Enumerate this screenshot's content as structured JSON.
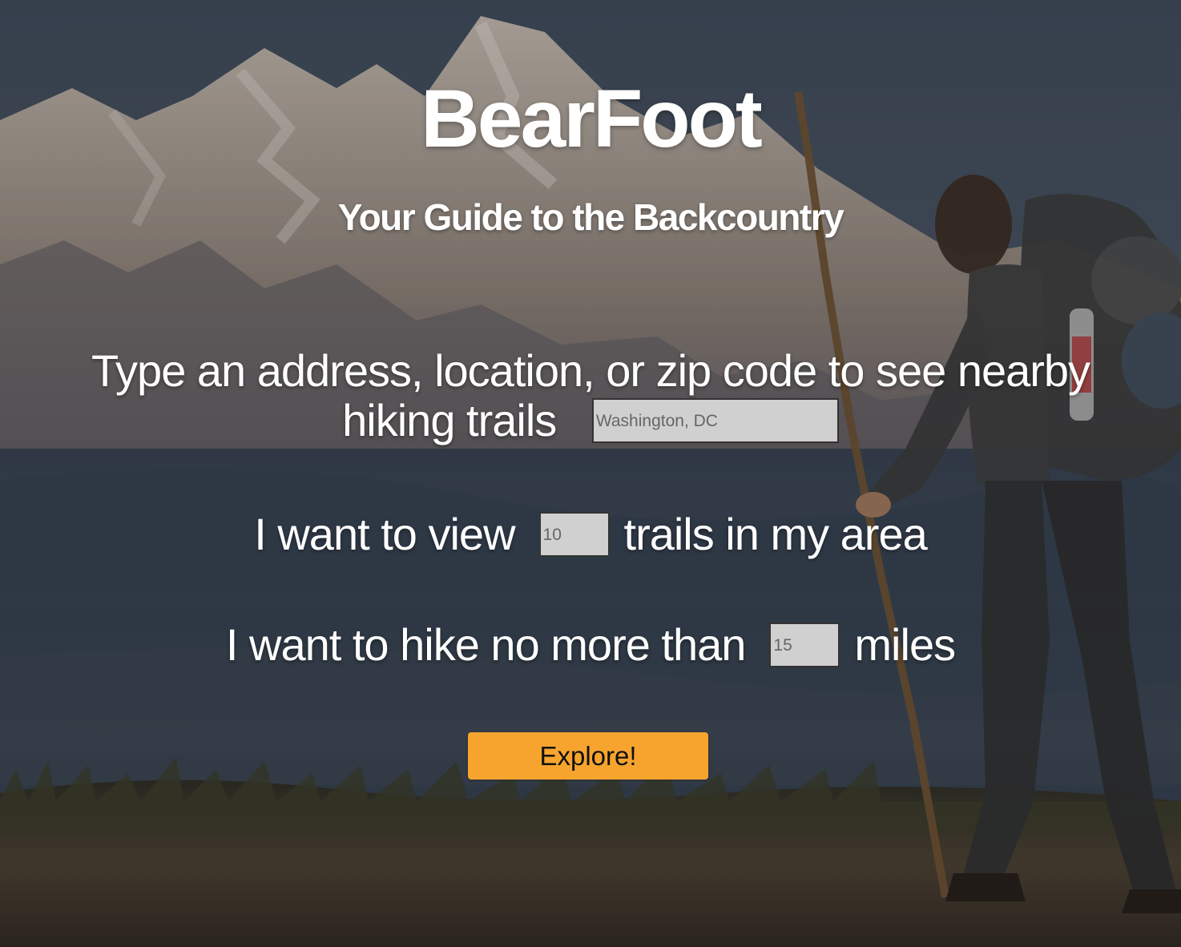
{
  "brand": {
    "title": "BearFoot",
    "tagline": "Your Guide to the Backcountry"
  },
  "form": {
    "location_prompt": "Type an address, location, or zip code to see nearby hiking trails",
    "location_placeholder": "Washington, DC",
    "count_prompt_before": "I want to view",
    "count_placeholder": "10",
    "count_prompt_after": "trails in my area",
    "distance_prompt_before": "I want to hike no more than",
    "distance_placeholder": "15",
    "distance_prompt_after": "miles",
    "submit_label": "Explore!"
  },
  "colors": {
    "accent": "#f7a42e",
    "input_bg": "#d0d0d0",
    "text": "#ffffff"
  }
}
